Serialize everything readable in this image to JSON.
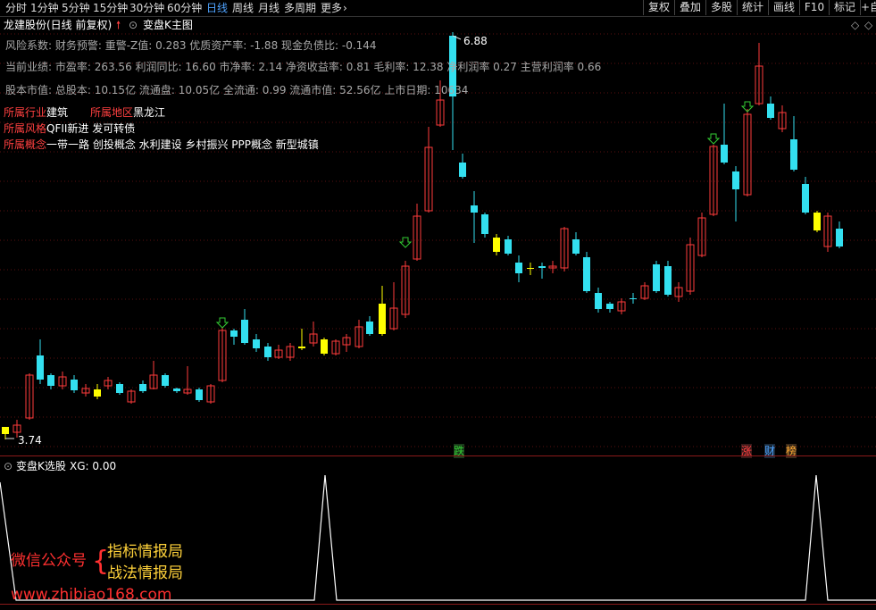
{
  "toolbar": {
    "periods": [
      "分时",
      "1分钟",
      "5分钟",
      "15分钟",
      "30分钟",
      "60分钟",
      "日线",
      "周线",
      "月线",
      "多周期",
      "更多"
    ],
    "more_arrow": "›",
    "right_buttons": [
      "复权",
      "叠加",
      "多股",
      "统计",
      "画线",
      "F10",
      "标记",
      "+自"
    ]
  },
  "header": {
    "stock_title": "龙建股份(日线 前复权)",
    "indicator_name": "变盘K主图",
    "diamond1": "◇",
    "diamond2": "◇"
  },
  "info": {
    "line1": "风险系数: 财务预警: 重警-Z值: 0.283 优质资产率: -1.88 现金负债比: -0.144",
    "line2": "当前业绩: 市盈率: 263.56 利润同比: 16.60 市净率: 2.14 净资收益率: 0.81 毛利率: 12.38 净利润率 0.27 主营利润率 0.66",
    "line3": "股本市值: 总股本: 10.15亿 流通盘: 10.05亿 全流通: 0.99 流通市值: 52.56亿 上市日期: 10634",
    "industry_label": "所属行业",
    "industry_value": "建筑",
    "region_label": "所属地区",
    "region_value": "黑龙江",
    "style_label": "所属风格",
    "style_value": "QFII新进 发可转债",
    "concept_label": "所属概念",
    "concept_value": "一带一路 创投概念 水利建设 乡村振兴 PPP概念 新型城镇"
  },
  "chart_data": {
    "type": "candlestick",
    "price_range": [
      3.74,
      6.88
    ],
    "high_label": "6.88",
    "low_label": "3.74",
    "markers": [
      "跌",
      "涨",
      "财",
      "榜"
    ],
    "sub_indicator": {
      "name": "变盘K选股",
      "value_label": "XG: 0.00",
      "peaks": [
        1,
        1,
        1
      ],
      "baseline": 0
    }
  },
  "watermark": {
    "wechat": "微信公众号",
    "brand1": "指标情报局",
    "brand2": "战法情报局",
    "url": "www.zhibiao168.com"
  },
  "colors": {
    "up": "#ff3b3b",
    "down": "#33e0f0",
    "doji": "#ffff00",
    "marker_green": "#33cc33",
    "accent_blue": "#4fa3ff"
  }
}
